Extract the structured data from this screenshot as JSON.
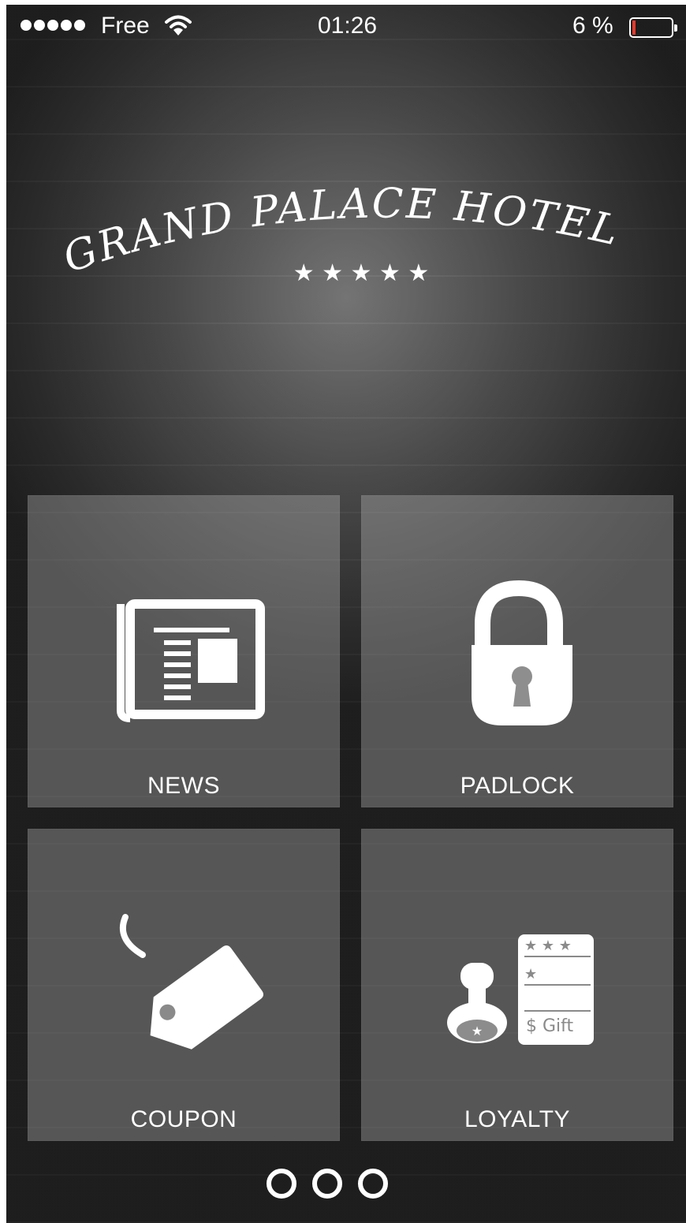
{
  "status_bar": {
    "carrier": "Free",
    "time": "01:26",
    "battery_percent": "6 %",
    "battery_level": 0.06,
    "signal_dots": 5
  },
  "hotel": {
    "name": "GRAND PALACE HOTEL",
    "stars": "★ ★ ★ ★ ★",
    "star_count": 5
  },
  "menu": {
    "news": "NEWS",
    "padlock": "PADLOCK",
    "coupon": "COUPON",
    "loyalty": "LOYALTY"
  },
  "loyalty_card": {
    "stars_row1": "★ ★ ★",
    "stars_row2": "★",
    "gift": "$ Gift"
  },
  "pager": {
    "pages": 3
  },
  "colors": {
    "text": "#ffffff",
    "battery_low": "#e23b2e",
    "tile": "#a8a8a8",
    "background": "#2a2a2a"
  }
}
